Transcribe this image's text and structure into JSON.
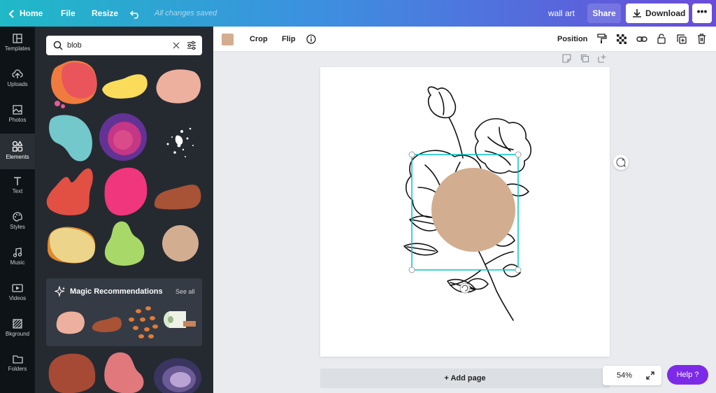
{
  "topbar": {
    "home": "Home",
    "file": "File",
    "resize": "Resize",
    "saved_status": "All changes saved",
    "design_title": "wall art",
    "share": "Share",
    "download": "Download"
  },
  "rail": [
    {
      "label": "Templates",
      "icon": "templates-icon"
    },
    {
      "label": "Uploads",
      "icon": "upload-icon"
    },
    {
      "label": "Photos",
      "icon": "photos-icon"
    },
    {
      "label": "Elements",
      "icon": "elements-icon",
      "active": true
    },
    {
      "label": "Text",
      "icon": "text-icon"
    },
    {
      "label": "Styles",
      "icon": "palette-icon"
    },
    {
      "label": "Music",
      "icon": "music-icon"
    },
    {
      "label": "Videos",
      "icon": "video-icon"
    },
    {
      "label": "Bkground",
      "icon": "background-icon"
    },
    {
      "label": "Folders",
      "icon": "folder-icon"
    }
  ],
  "search": {
    "value": "blob"
  },
  "magic": {
    "title": "Magic Recommendations",
    "see_all": "See all"
  },
  "context_toolbar": {
    "swatch_color": "#d2ad90",
    "crop": "Crop",
    "flip": "Flip",
    "position": "Position"
  },
  "canvas": {
    "add_page": "+ Add page"
  },
  "zoom": "54%",
  "help": "Help ?",
  "colors": {
    "accent": "#7d2ae8",
    "selection": "#00c4cc",
    "blob_fill": "#d2ad90"
  }
}
